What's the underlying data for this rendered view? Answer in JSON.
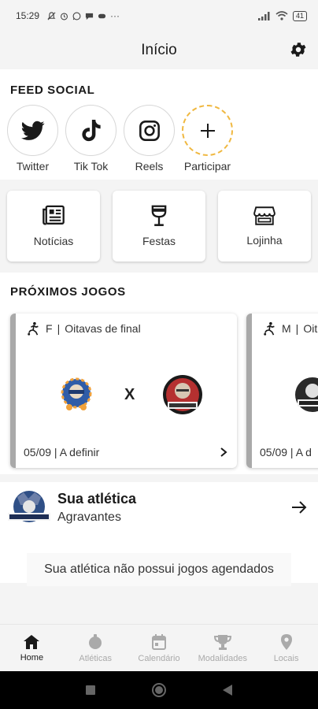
{
  "status_bar": {
    "time": "15:29",
    "battery": "41",
    "more": "···"
  },
  "header": {
    "title": "Início"
  },
  "feed": {
    "title": "FEED SOCIAL",
    "items": [
      {
        "label": "Twitter",
        "icon": "twitter-icon"
      },
      {
        "label": "Tik Tok",
        "icon": "tiktok-icon"
      },
      {
        "label": "Reels",
        "icon": "instagram-icon"
      },
      {
        "label": "Participar",
        "icon": "plus-icon"
      }
    ]
  },
  "quick": [
    {
      "label": "Notícias",
      "icon": "newspaper-icon"
    },
    {
      "label": "Festas",
      "icon": "wine-glass-icon"
    },
    {
      "label": "Lojinha",
      "icon": "store-icon"
    }
  ],
  "games": {
    "title": "PRÓXIMOS JOGOS",
    "cards": [
      {
        "gender": "F",
        "phase": "Oitavas de final",
        "vs": "X",
        "date": "05/09",
        "location": "A definir"
      },
      {
        "gender": "M",
        "phase": "Oit",
        "date": "05/09",
        "location": "A d"
      }
    ]
  },
  "atletica": {
    "title": "Sua atlética",
    "name": "Agravantes",
    "empty": "Sua atlética não possui jogos agendados"
  },
  "nav": [
    {
      "label": "Home",
      "icon": "home-icon",
      "active": true
    },
    {
      "label": "Atléticas",
      "icon": "ball-icon",
      "active": false
    },
    {
      "label": "Calendário",
      "icon": "calendar-icon",
      "active": false
    },
    {
      "label": "Modalidades",
      "icon": "trophy-icon",
      "active": false
    },
    {
      "label": "Locais",
      "icon": "location-pin-icon",
      "active": false
    }
  ],
  "colors": {
    "accent": "#f0b840",
    "card_stripe": "#a9a9a9",
    "nav_inactive": "#aaaaaa"
  }
}
